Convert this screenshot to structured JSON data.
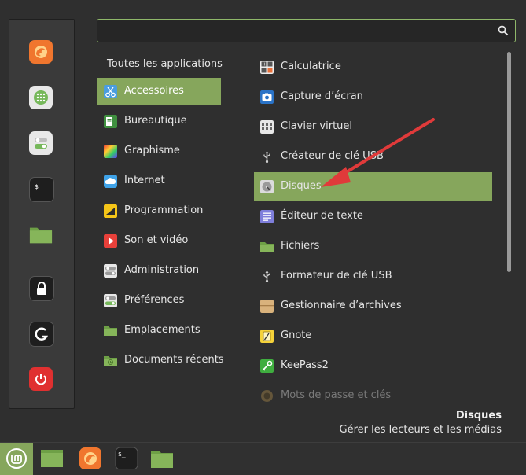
{
  "search": {
    "value": "",
    "placeholder": ""
  },
  "categories": {
    "header": "Toutes les applications",
    "items": [
      {
        "label": "Accessoires",
        "icon": "scissors-icon",
        "active": true
      },
      {
        "label": "Bureautique",
        "icon": "office-icon"
      },
      {
        "label": "Graphisme",
        "icon": "graphics-icon"
      },
      {
        "label": "Internet",
        "icon": "cloud-icon"
      },
      {
        "label": "Programmation",
        "icon": "programming-icon"
      },
      {
        "label": "Son et vidéo",
        "icon": "play-icon"
      },
      {
        "label": "Administration",
        "icon": "admin-toggle-icon"
      },
      {
        "label": "Préférences",
        "icon": "preferences-toggle-icon"
      },
      {
        "label": "Emplacements",
        "icon": "folder-icon"
      },
      {
        "label": "Documents récents",
        "icon": "recent-folder-icon"
      }
    ]
  },
  "apps": [
    {
      "label": "Calculatrice",
      "icon": "calculator-icon"
    },
    {
      "label": "Capture d’écran",
      "icon": "camera-icon"
    },
    {
      "label": "Clavier virtuel",
      "icon": "keyboard-icon"
    },
    {
      "label": "Créateur de clé USB",
      "icon": "usb-icon"
    },
    {
      "label": "Disques",
      "icon": "disk-icon",
      "active": true
    },
    {
      "label": "Éditeur de texte",
      "icon": "text-editor-icon"
    },
    {
      "label": "Fichiers",
      "icon": "folder-icon"
    },
    {
      "label": "Formateur de clé USB",
      "icon": "usb-icon"
    },
    {
      "label": "Gestionnaire d’archives",
      "icon": "archive-icon"
    },
    {
      "label": "Gnote",
      "icon": "note-icon"
    },
    {
      "label": "KeePass2",
      "icon": "key-icon"
    },
    {
      "label": "Mots de passe et clés",
      "icon": "seahorse-icon",
      "dim": true
    }
  ],
  "description": {
    "title": "Disques",
    "text": "Gérer les lecteurs et les médias"
  },
  "favorites": [
    "firefox-icon",
    "software-manager-icon",
    "settings-toggle-icon",
    "terminal-icon",
    "files-folder-icon",
    "lock-icon",
    "logout-icon",
    "power-icon"
  ],
  "taskbar": [
    "mint-menu-icon",
    "show-desktop-icon",
    "firefox-icon",
    "terminal-icon",
    "files-folder-icon"
  ],
  "colors": {
    "accent": "#86a65c",
    "background": "#2f2f2f",
    "annotation_arrow": "#e03a3a"
  }
}
